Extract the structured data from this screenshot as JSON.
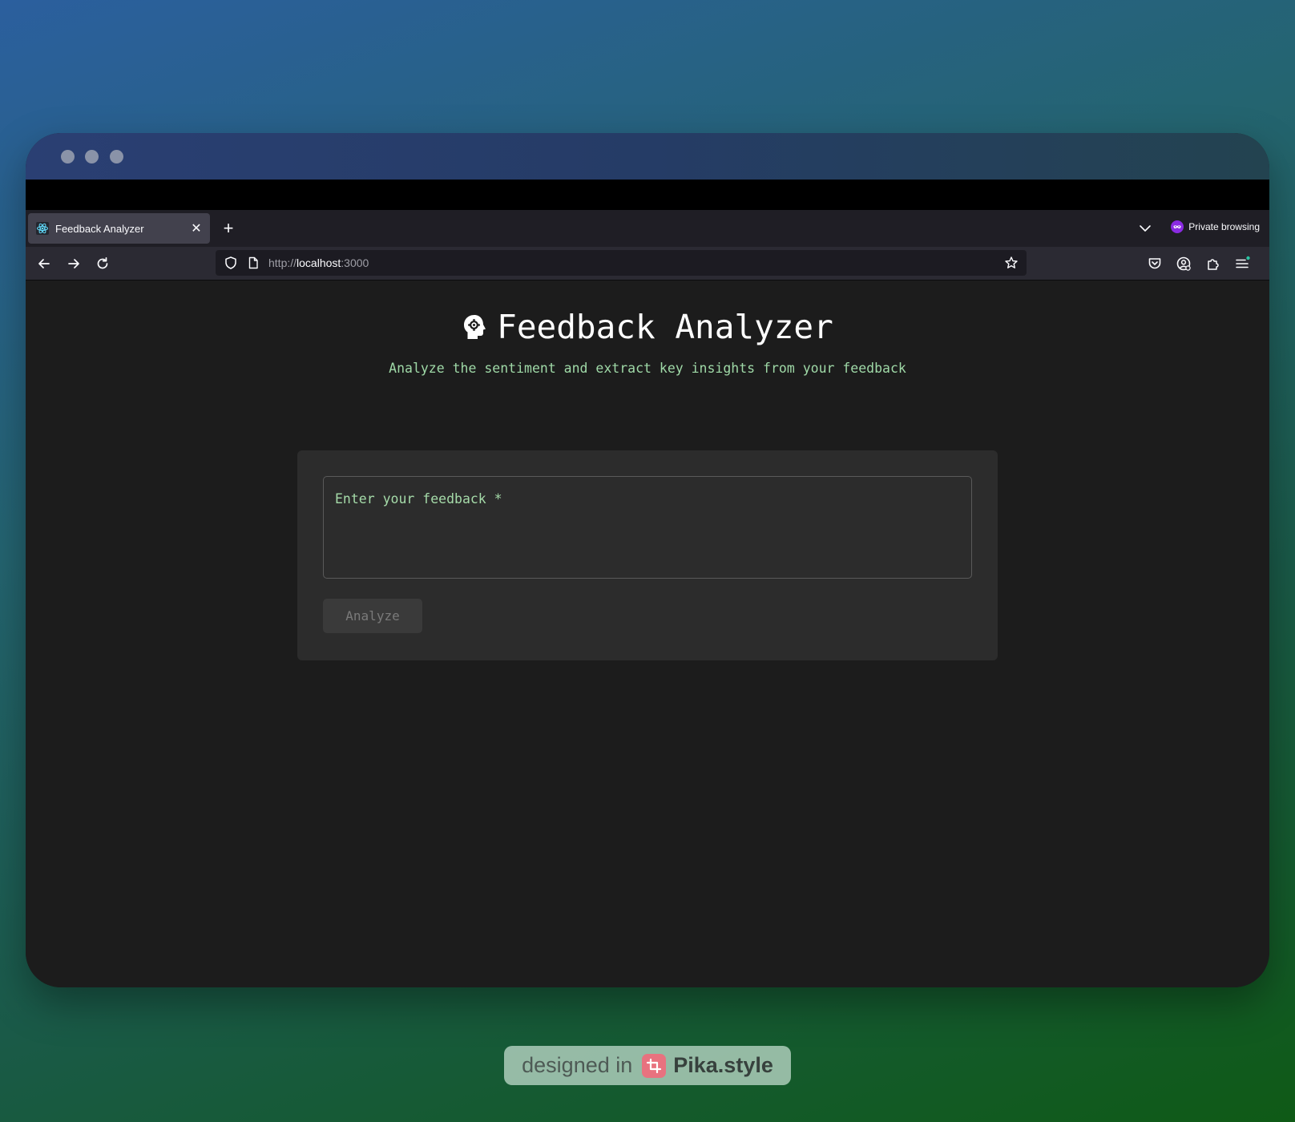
{
  "browser": {
    "tab_title": "Feedback Analyzer",
    "tab_close": "✕",
    "new_tab": "+",
    "private_label": "Private browsing",
    "url_scheme": "http://",
    "url_host": "localhost",
    "url_port": ":3000"
  },
  "page": {
    "title": "Feedback Analyzer",
    "subtitle": "Analyze the sentiment and extract key insights from your feedback",
    "feedback_placeholder": "Enter your feedback *",
    "analyze_label": "Analyze"
  },
  "badge": {
    "prefix": "designed in",
    "brand": "Pika.style"
  },
  "icons": {
    "tab_favicon": "react-icon",
    "heading": "psychology-head-gear-icon",
    "private": "private-mask-icon"
  },
  "colors": {
    "accent_text": "#9fd9a7",
    "content_background": "#1c1c1c",
    "card_background": "#2c2c2c"
  }
}
